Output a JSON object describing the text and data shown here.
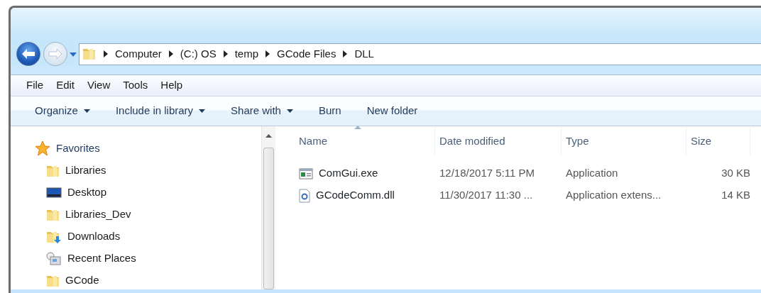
{
  "address_bar": {
    "crumbs": [
      "Computer",
      "(C:) OS",
      "temp",
      "GCode Files",
      "DLL"
    ]
  },
  "menu_bar": [
    "File",
    "Edit",
    "View",
    "Tools",
    "Help"
  ],
  "toolbar": [
    {
      "label": "Organize",
      "dropdown": true
    },
    {
      "label": "Include in library",
      "dropdown": true
    },
    {
      "label": "Share with",
      "dropdown": true
    },
    {
      "label": "Burn",
      "dropdown": false
    },
    {
      "label": "New folder",
      "dropdown": false
    }
  ],
  "sidebar": {
    "items": [
      {
        "label": "Favorites",
        "kind": "star",
        "children": [
          {
            "label": "Libraries",
            "kind": "folder"
          },
          {
            "label": "Desktop",
            "kind": "desktop"
          },
          {
            "label": "Libraries_Dev",
            "kind": "folder"
          },
          {
            "label": "Downloads",
            "kind": "downloads"
          },
          {
            "label": "Recent Places",
            "kind": "recent"
          },
          {
            "label": "GCode",
            "kind": "folder"
          }
        ]
      }
    ]
  },
  "table": {
    "columns": [
      {
        "label": "Name",
        "sorted": true
      },
      {
        "label": "Date modified",
        "sorted": false
      },
      {
        "label": "Type",
        "sorted": false
      },
      {
        "label": "Size",
        "sorted": false
      }
    ],
    "rows": [
      {
        "kind": "exe",
        "cells": [
          "ComGui.exe",
          "12/18/2017 5:11 PM",
          "Application",
          "30 KB"
        ]
      },
      {
        "kind": "dll",
        "cells": [
          "GCodeComm.dll",
          "11/30/2017 11:30 ...",
          "Application extens...",
          "14 KB"
        ]
      }
    ]
  }
}
